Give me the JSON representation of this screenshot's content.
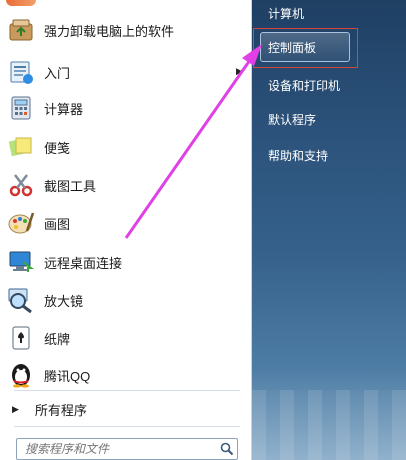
{
  "left_panel": {
    "items": [
      {
        "label": "强力卸载电脑上的软件",
        "icon": "uninstall-box-icon"
      },
      {
        "label": "入门",
        "icon": "getting-started-icon"
      },
      {
        "label": "计算器",
        "icon": "calculator-icon"
      },
      {
        "label": "便笺",
        "icon": "sticky-notes-icon"
      },
      {
        "label": "截图工具",
        "icon": "snipping-tool-icon"
      },
      {
        "label": "画图",
        "icon": "paint-palette-icon"
      },
      {
        "label": "远程桌面连接",
        "icon": "remote-desktop-icon"
      },
      {
        "label": "放大镜",
        "icon": "magnifier-icon"
      },
      {
        "label": "纸牌",
        "icon": "solitaire-card-icon"
      },
      {
        "label": "腾讯QQ",
        "icon": "qq-penguin-icon"
      }
    ],
    "all_programs": "所有程序",
    "search_placeholder": "搜索程序和文件"
  },
  "right_panel": {
    "items": [
      {
        "label": "计算机"
      },
      {
        "label": "控制面板"
      },
      {
        "label": "设备和打印机"
      },
      {
        "label": "默认程序"
      },
      {
        "label": "帮助和支持"
      }
    ]
  },
  "colors": {
    "right_pane_top": "#1f3f63",
    "right_pane_bottom": "#8fb0cb",
    "annotation_arrow": "#e040e6",
    "highlight_box": "#d8433c"
  }
}
